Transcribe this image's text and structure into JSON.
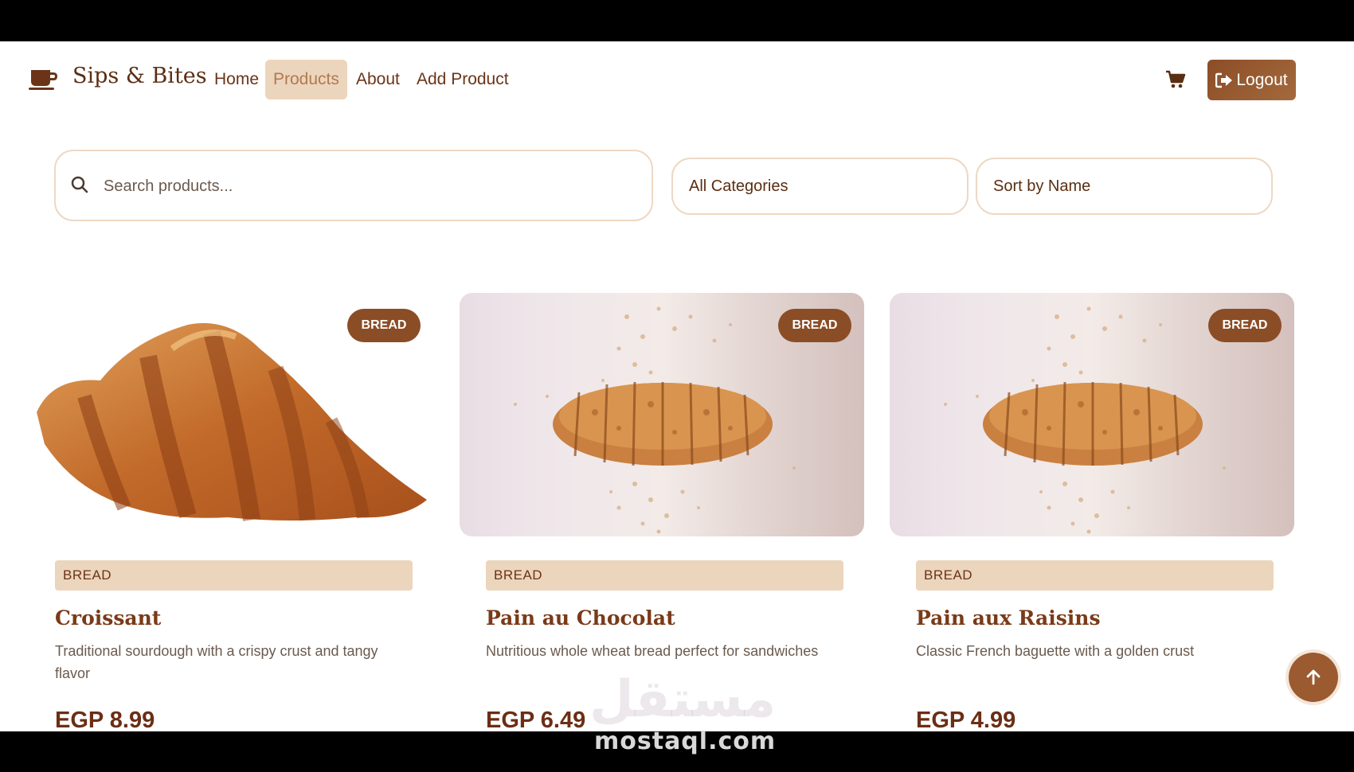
{
  "nav": {
    "brand": "Sips & Bites",
    "links": [
      {
        "label": "Home",
        "active": false
      },
      {
        "label": "Products",
        "active": true
      },
      {
        "label": "About",
        "active": false
      },
      {
        "label": "Add Product",
        "active": false
      }
    ],
    "logout_label": "Logout"
  },
  "filters": {
    "search_placeholder": "Search products...",
    "category_selected": "All Categories",
    "sort_selected": "Sort by Name"
  },
  "products": [
    {
      "badge": "BREAD",
      "category": "BREAD",
      "name": "Croissant",
      "description": "Traditional sourdough with a crispy crust and tangy flavor",
      "price": "EGP 8.99",
      "image": "croissant"
    },
    {
      "badge": "BREAD",
      "category": "BREAD",
      "name": "Pain au Chocolat",
      "description": "Nutritious whole wheat bread perfect for sandwiches",
      "price": "EGP 6.49",
      "image": "sliced-loaf"
    },
    {
      "badge": "BREAD",
      "category": "BREAD",
      "name": "Pain aux Raisins",
      "description": "Classic French baguette with a golden crust",
      "price": "EGP 4.99",
      "image": "sliced-loaf"
    }
  ],
  "watermark": {
    "arabic": "مستقل",
    "text": "mostaql.com"
  },
  "colors": {
    "brand_brown": "#8b4d26",
    "accent_beige": "#ecd5bd",
    "text_dark": "#5a2e12"
  }
}
